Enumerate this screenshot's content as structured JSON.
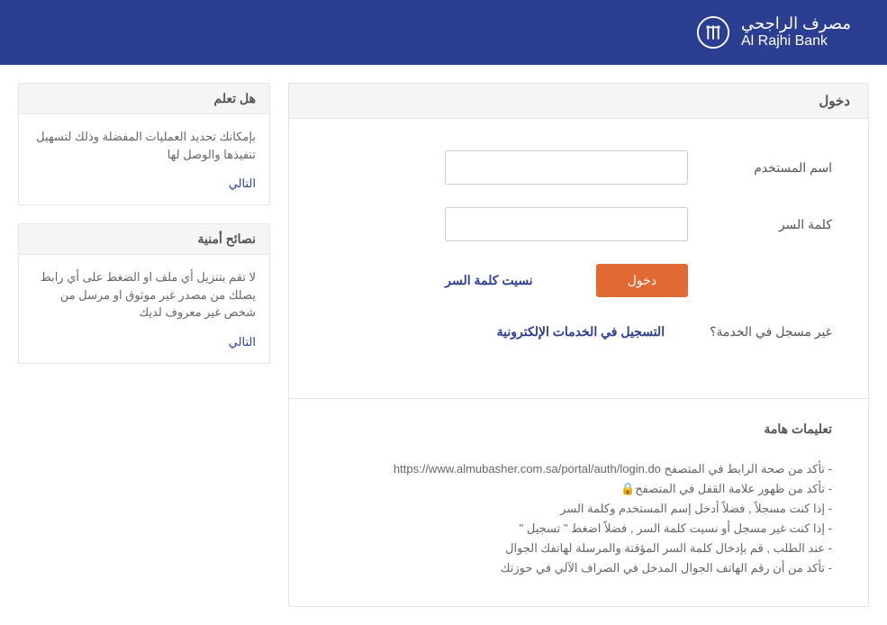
{
  "header": {
    "logo_ar": "مصرف الراجحي",
    "logo_en": "Al Rajhi Bank"
  },
  "login": {
    "title": "دخول",
    "username_label": "اسم المستخدم",
    "password_label": "كلمة السر",
    "login_button": "دخول",
    "forgot_link": "نسيت كلمة السر",
    "not_registered": "غير مسجل في الخدمة؟",
    "register_link": "التسجيل في الخدمات الإلكترونية"
  },
  "instructions": {
    "title": "تعليمات هامة",
    "items": [
      "تأكد من صحة الرابط في المتصفح https://www.almubasher.com.sa/portal/auth/login.do",
      "تأكد من ظهور علامة القفل في المتصفح🔒",
      "إذا كنت مسجلاً , فضلاً أدخل إسم المستخدم وكلمة السر",
      "إذا كنت غير مسجل أو نسيت كلمة السر , فضلاً اضغط \" تسجيل \"",
      "عند الطلب , قم بإدخال كلمة السر المؤقتة والمرسلة لهاتفك الجوال",
      "تأكد من أن رقم الهاتف الجوال المدخل في الصراف الآلي في حوزتك"
    ]
  },
  "sidebar": {
    "tips": {
      "title": "هل تعلم",
      "body": "بإمكانك تحديد العمليات المفضلة وذلك لتسهيل تنفيذها والوصل لها",
      "next": "التالي"
    },
    "security": {
      "title": "نصائح أمنية",
      "body": "لا تقم بتنزيل أي ملف او الضغط على أي رابط يصلك من مصدر غير موثوق او مرسل من شخص غير معروف لديك",
      "next": "التالي"
    }
  }
}
